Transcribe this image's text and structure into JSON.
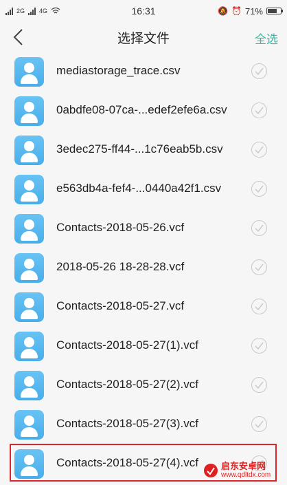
{
  "status_bar": {
    "carrier_left": "2G",
    "carrier_right": "4G",
    "time": "16:31",
    "battery_text": "71%",
    "battery_level": 0.71
  },
  "header": {
    "title": "选择文件",
    "select_all": "全选"
  },
  "files": [
    {
      "name": "mediastorage_trace.csv"
    },
    {
      "name": "0abdfe08-07ca-...edef2efe6a.csv"
    },
    {
      "name": "3edec275-ff44-...1c76eab5b.csv"
    },
    {
      "name": "e563db4a-fef4-...0440a42f1.csv"
    },
    {
      "name": "Contacts-2018-05-26.vcf"
    },
    {
      "name": "2018-05-26 18-28-28.vcf"
    },
    {
      "name": "Contacts-2018-05-27.vcf"
    },
    {
      "name": "Contacts-2018-05-27(1).vcf"
    },
    {
      "name": "Contacts-2018-05-27(2).vcf"
    },
    {
      "name": "Contacts-2018-05-27(3).vcf"
    },
    {
      "name": "Contacts-2018-05-27(4).vcf"
    }
  ],
  "watermark": {
    "name": "启东安卓网",
    "url": "www.qdltdx.com"
  },
  "colors": {
    "accent": "#39b8a4",
    "icon_blue": "#55b6ee",
    "highlight_red": "#d8262c"
  }
}
